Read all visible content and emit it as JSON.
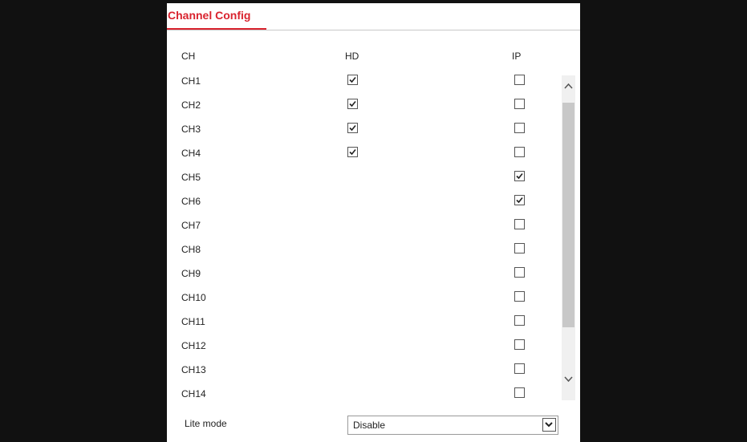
{
  "tab": {
    "label": "Channel Config"
  },
  "headers": {
    "ch": "CH",
    "hd": "HD",
    "ip": "IP"
  },
  "channels": [
    {
      "label": "CH1",
      "hd": true,
      "ip": false
    },
    {
      "label": "CH2",
      "hd": true,
      "ip": false
    },
    {
      "label": "CH3",
      "hd": true,
      "ip": false
    },
    {
      "label": "CH4",
      "hd": true,
      "ip": false
    },
    {
      "label": "CH5",
      "hd": null,
      "ip": true
    },
    {
      "label": "CH6",
      "hd": null,
      "ip": true
    },
    {
      "label": "CH7",
      "hd": null,
      "ip": false
    },
    {
      "label": "CH8",
      "hd": null,
      "ip": false
    },
    {
      "label": "CH9",
      "hd": null,
      "ip": false
    },
    {
      "label": "CH10",
      "hd": null,
      "ip": false
    },
    {
      "label": "CH11",
      "hd": null,
      "ip": false
    },
    {
      "label": "CH12",
      "hd": null,
      "ip": false
    },
    {
      "label": "CH13",
      "hd": null,
      "ip": false
    },
    {
      "label": "CH14",
      "hd": null,
      "ip": false
    }
  ],
  "lite_mode": {
    "label": "Lite mode",
    "value": "Disable"
  },
  "colors": {
    "accent": "#d9232e"
  }
}
